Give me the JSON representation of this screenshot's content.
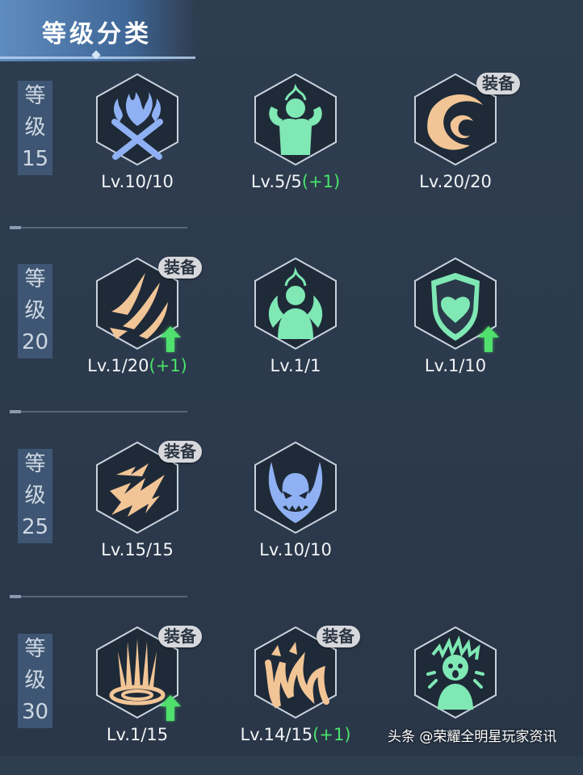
{
  "header": {
    "title": "等级分类"
  },
  "sections": [
    {
      "tag": [
        "等",
        "级",
        "15"
      ],
      "skills": [
        {
          "icon": "blue-flame-swords-icon",
          "level": "Lv.10/10",
          "bonus": "",
          "badge": "",
          "upgrade": false
        },
        {
          "icon": "green-flexing-figure-icon",
          "level": "Lv.5/5",
          "bonus": "(+1)",
          "badge": "",
          "upgrade": false
        },
        {
          "icon": "orange-swirl-icon",
          "level": "Lv.20/20",
          "bonus": "",
          "badge": "装备",
          "upgrade": false
        }
      ]
    },
    {
      "tag": [
        "等",
        "级",
        "20"
      ],
      "skills": [
        {
          "icon": "orange-claw-slash-icon",
          "level": "Lv.1/20",
          "bonus": "(+1)",
          "badge": "装备",
          "upgrade": true
        },
        {
          "icon": "green-flaming-figure-icon",
          "level": "Lv.1/1",
          "bonus": "",
          "badge": "",
          "upgrade": false
        },
        {
          "icon": "green-heart-shield-icon",
          "level": "Lv.1/10",
          "bonus": "",
          "badge": "",
          "upgrade": true
        }
      ]
    },
    {
      "tag": [
        "等",
        "级",
        "25"
      ],
      "skills": [
        {
          "icon": "orange-lightning-strike-icon",
          "level": "Lv.15/15",
          "bonus": "",
          "badge": "装备",
          "upgrade": false
        },
        {
          "icon": "blue-demon-face-icon",
          "level": "Lv.10/10",
          "bonus": "",
          "badge": "",
          "upgrade": false
        }
      ]
    },
    {
      "tag": [
        "等",
        "级",
        "30"
      ],
      "skills": [
        {
          "icon": "orange-ground-burst-icon",
          "level": "Lv.1/15",
          "bonus": "",
          "badge": "装备",
          "upgrade": true
        },
        {
          "icon": "orange-beast-slash-icon",
          "level": "Lv.14/15",
          "bonus": "(+1)",
          "badge": "装备",
          "upgrade": false
        },
        {
          "icon": "green-screaming-figure-icon",
          "level": "",
          "bonus": "",
          "badge": "",
          "upgrade": false
        }
      ]
    }
  ],
  "watermark": "头条 @荣耀全明星玩家资讯",
  "colors": {
    "bonus": "#49e46a",
    "tag_bg": "#3e5673",
    "badge_bg": "#d6d8dc",
    "hex_bg": "#1f2a38",
    "icon_blue": "#8fb1f4",
    "icon_green": "#7fe8b4",
    "icon_orange": "#f2c596",
    "arrow": "#4fe06e"
  }
}
